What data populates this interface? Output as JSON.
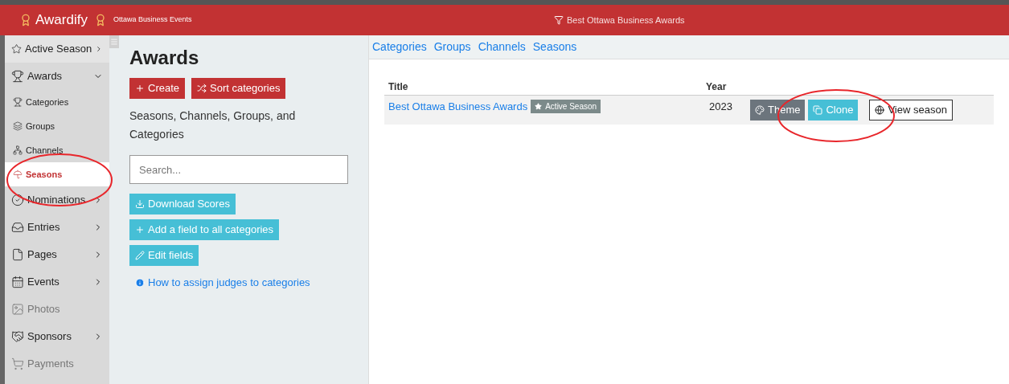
{
  "header": {
    "brand": "Awardify",
    "organization": "Ottawa Business Events",
    "season_filter": "Best Ottawa Business Awards"
  },
  "sidebar": {
    "items": [
      {
        "label": "Active Season",
        "expanded": false,
        "disabled": false,
        "selected": false
      },
      {
        "label": "Awards",
        "expanded": true,
        "disabled": false,
        "selected": false,
        "children": [
          {
            "label": "Categories",
            "selected": false
          },
          {
            "label": "Groups",
            "selected": false
          },
          {
            "label": "Channels",
            "selected": false
          },
          {
            "label": "Seasons",
            "selected": true
          }
        ]
      },
      {
        "label": "Nominations",
        "expanded": false,
        "disabled": false,
        "selected": false
      },
      {
        "label": "Entries",
        "expanded": false,
        "disabled": false,
        "selected": false
      },
      {
        "label": "Pages",
        "expanded": false,
        "disabled": false,
        "selected": false
      },
      {
        "label": "Events",
        "expanded": false,
        "disabled": false,
        "selected": false
      },
      {
        "label": "Photos",
        "disabled": true,
        "selected": false
      },
      {
        "label": "Sponsors",
        "expanded": false,
        "disabled": false,
        "selected": false
      },
      {
        "label": "Payments",
        "disabled": true,
        "selected": false
      }
    ]
  },
  "panel": {
    "title": "Awards",
    "primary_buttons": [
      "Create",
      "Sort categories"
    ],
    "description": "Seasons, Channels, Groups, and Categories",
    "search": {
      "placeholder": "Search..."
    },
    "action_buttons": [
      "Download Scores",
      "Add a field to all categories",
      "Edit fields"
    ],
    "help_link": "How to assign judges to categories"
  },
  "content": {
    "tabs": [
      "Categories",
      "Groups",
      "Channels",
      "Seasons"
    ],
    "table": {
      "columns": [
        "Title",
        "Year"
      ],
      "rows": [
        {
          "title": "Best Ottawa Business Awards",
          "badge": "Active Season",
          "year": "2023",
          "actions": [
            "Theme",
            "Clone",
            "View season"
          ]
        }
      ]
    }
  }
}
